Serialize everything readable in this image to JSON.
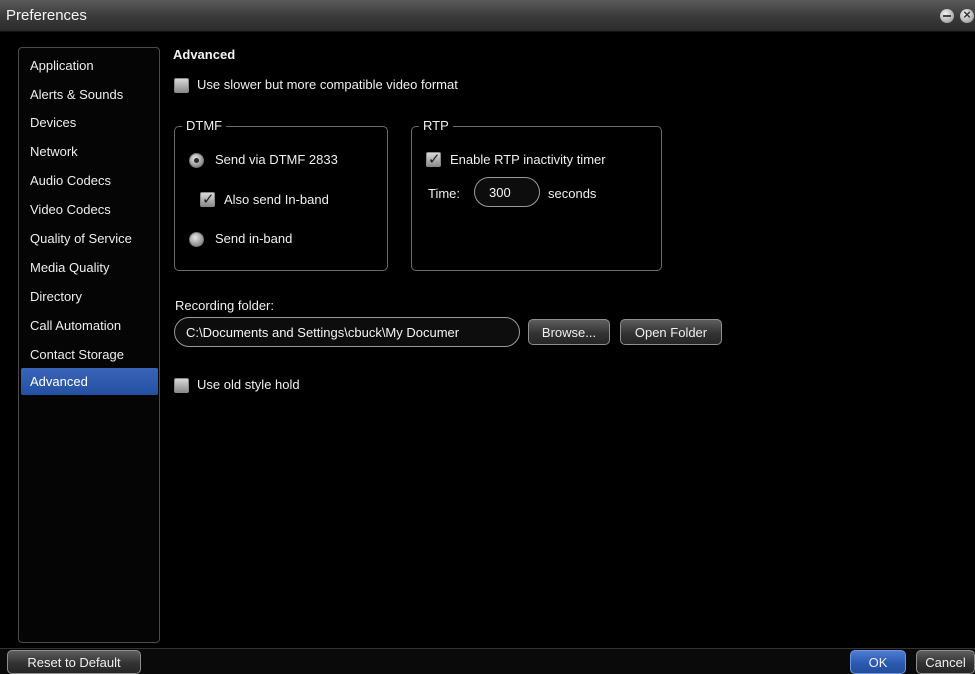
{
  "window": {
    "title": "Preferences",
    "min_icon": "minimize-icon",
    "close_icon": "close-icon"
  },
  "sidebar": {
    "items": [
      {
        "label": "Application"
      },
      {
        "label": "Alerts & Sounds"
      },
      {
        "label": "Devices"
      },
      {
        "label": "Network"
      },
      {
        "label": "Audio Codecs"
      },
      {
        "label": "Video Codecs"
      },
      {
        "label": "Quality of Service"
      },
      {
        "label": "Media Quality"
      },
      {
        "label": "Directory"
      },
      {
        "label": "Call Automation"
      },
      {
        "label": "Contact Storage"
      },
      {
        "label": "Advanced"
      }
    ],
    "selected": "Advanced",
    "accent_color": "#2f5bb0"
  },
  "panel": {
    "title": "Advanced",
    "slower_video": {
      "label": "Use slower but more compatible video format",
      "checked": false
    },
    "dtmf": {
      "legend": "DTMF",
      "send_2833": {
        "label": "Send via DTMF 2833",
        "selected": true
      },
      "also_inband": {
        "label": "Also send In-band",
        "checked": true
      },
      "send_inband": {
        "label": "Send in-band",
        "selected": false
      }
    },
    "rtp": {
      "legend": "RTP",
      "inactivity": {
        "label": "Enable RTP inactivity timer",
        "checked": true
      },
      "time_label": "Time:",
      "time_value": "300",
      "seconds_label": "seconds"
    },
    "recording": {
      "label": "Recording folder:",
      "path": "C:\\Documents and Settings\\cbuck\\My Documer",
      "browse": "Browse...",
      "open_folder": "Open Folder"
    },
    "old_hold": {
      "label": "Use old style hold",
      "checked": false
    }
  },
  "footer": {
    "reset": "Reset to Default",
    "ok": "OK",
    "cancel": "Cancel"
  }
}
